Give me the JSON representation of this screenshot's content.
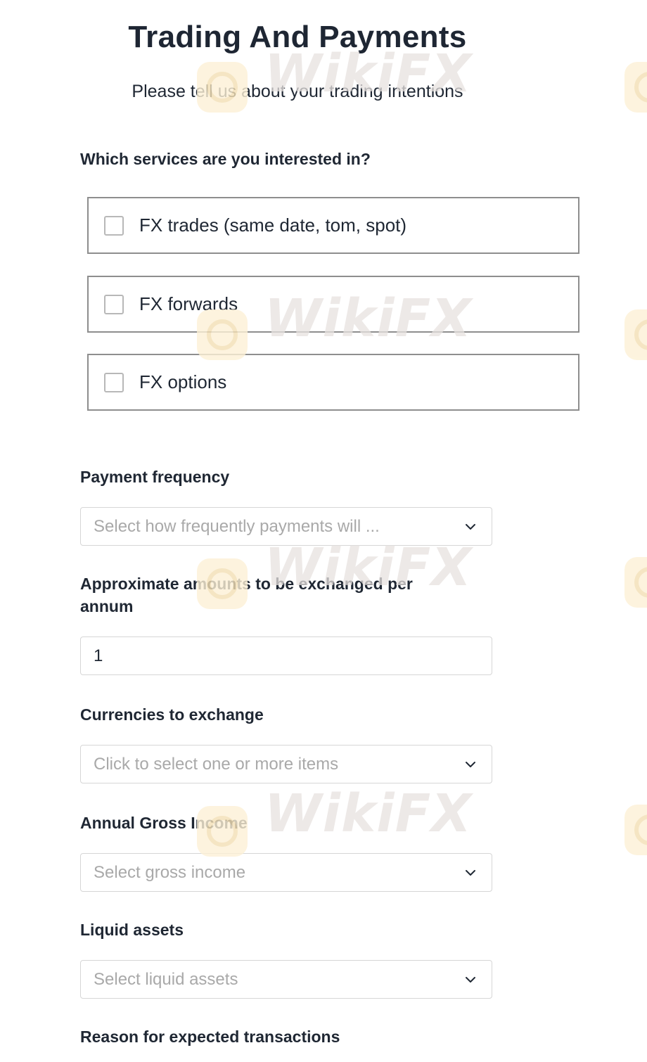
{
  "header": {
    "title": "Trading And Payments",
    "subtitle": "Please tell us about your trading intentions"
  },
  "services": {
    "label": "Which services are you interested in?",
    "options": [
      {
        "label": "FX trades (same date, tom, spot)",
        "checked": false
      },
      {
        "label": "FX forwards",
        "checked": false
      },
      {
        "label": "FX options",
        "checked": false
      }
    ]
  },
  "payment_frequency": {
    "label": "Payment frequency",
    "placeholder": "Select how frequently payments will ..."
  },
  "amounts": {
    "label_line1": "Approximate amounts to be exchanged per",
    "label_line2": "annum",
    "value": "1"
  },
  "currencies": {
    "label": "Currencies to exchange",
    "placeholder": "Click to select one or more items"
  },
  "income": {
    "label": "Annual Gross Income",
    "placeholder": "Select gross income"
  },
  "liquid_assets": {
    "label": "Liquid assets",
    "placeholder": "Select liquid assets"
  },
  "reason": {
    "label": "Reason for expected transactions"
  },
  "watermark": {
    "text": "WikiFX"
  },
  "colors": {
    "text": "#1f2733",
    "placeholder": "#a9a9a9",
    "box_border": "#8e8e8e",
    "field_border": "#d6d6d6"
  },
  "icons": {
    "dropdown": "chevron-down-icon",
    "checkbox": "checkbox-empty-icon"
  }
}
